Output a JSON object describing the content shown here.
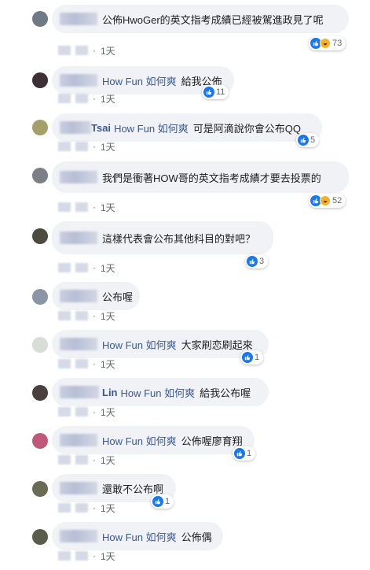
{
  "comments": [
    {
      "name_suffix": "",
      "mention": "",
      "text": "公佈HwoGer的英文指考成績已經被駕進政見了呢",
      "reactions": "73",
      "haha": true,
      "time": "1天",
      "avatar_color": "#6e7a86"
    },
    {
      "name_suffix": "",
      "mention": "How Fun 如何爽",
      "text": "給我公佈",
      "reactions": "11",
      "haha": false,
      "time": "1天",
      "avatar_color": "#3c3036"
    },
    {
      "name_suffix": "Tsai",
      "mention": "How Fun 如何爽",
      "text": "可是阿滴說你會公布QQ",
      "reactions": "5",
      "haha": false,
      "time": "1天",
      "avatar_color": "#a5a06a"
    },
    {
      "name_suffix": "",
      "mention": "",
      "text": "我們是衝著HOW哥的英文指考成績才要去投票的",
      "reactions": "52",
      "haha": true,
      "time": "1天",
      "avatar_color": "#7b7f86"
    },
    {
      "name_suffix": "",
      "mention": "",
      "text": "這樣代表會公布其他科目的對吧？",
      "reactions": "3",
      "haha": false,
      "time": "1天",
      "avatar_color": "#4d4a40"
    },
    {
      "name_suffix": "",
      "mention": "",
      "text": "公布喔",
      "reactions": "",
      "haha": false,
      "time": "1天",
      "avatar_color": "#8a95a5"
    },
    {
      "name_suffix": "",
      "mention": "How Fun 如何爽",
      "text": "大家刷恋刷起來",
      "reactions": "1",
      "haha": false,
      "time": "1天",
      "avatar_color": "#d6ded5"
    },
    {
      "name_suffix": "Lin",
      "mention": "How Fun 如何爽",
      "text": "給我公布喔",
      "reactions": "",
      "haha": false,
      "time": "1天",
      "avatar_color": "#4a4040"
    },
    {
      "name_suffix": "",
      "mention": "How Fun 如何爽",
      "text": "公佈喔廖育翔",
      "reactions": "1",
      "haha": false,
      "time": "1天",
      "avatar_color": "#c0587a"
    },
    {
      "name_suffix": "",
      "mention": "",
      "text": "還敢不公布啊",
      "reactions": "1",
      "haha": false,
      "time": "1天",
      "avatar_color": "#6a6a55"
    },
    {
      "name_suffix": "",
      "mention": "How Fun 如何爽",
      "text": "公佈偶",
      "reactions": "",
      "haha": false,
      "time": "1天",
      "avatar_color": "#5a5d4a"
    }
  ]
}
